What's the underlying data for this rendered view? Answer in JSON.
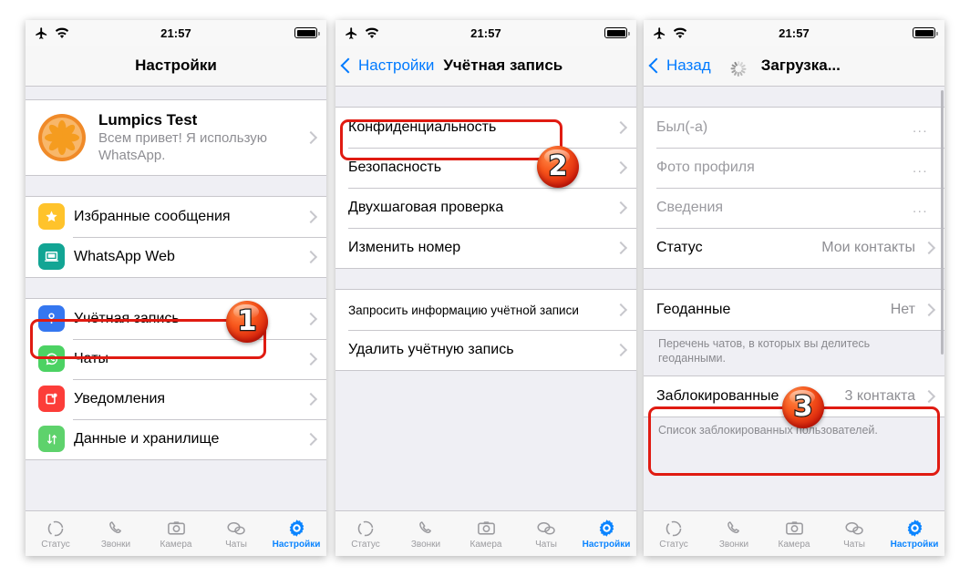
{
  "statusbar": {
    "time": "21:57",
    "airplane_icon": "airplane-icon",
    "wifi_icon": "wifi-icon",
    "battery_icon": "battery-icon"
  },
  "tabbar": {
    "items": [
      {
        "label": "Статус",
        "icon": "status-ring-icon",
        "active": false
      },
      {
        "label": "Звонки",
        "icon": "phone-icon",
        "active": false
      },
      {
        "label": "Камера",
        "icon": "camera-icon",
        "active": false
      },
      {
        "label": "Чаты",
        "icon": "chats-bubble-icon",
        "active": false
      },
      {
        "label": "Настройки",
        "icon": "gear-icon",
        "active": true
      }
    ]
  },
  "panel1": {
    "nav": {
      "title": "Настройки"
    },
    "profile": {
      "name": "Lumpics Test",
      "status": "Всем привет! Я использую WhatsApp.",
      "avatar": "orange-slice-avatar"
    },
    "group_a": [
      {
        "label": "Избранные сообщения",
        "icon": "star-icon",
        "color": "#ffc32b"
      },
      {
        "label": "WhatsApp Web",
        "icon": "laptop-icon",
        "color": "#12a594"
      }
    ],
    "group_b": [
      {
        "label": "Учётная запись",
        "icon": "key-icon",
        "color": "#3577f0"
      },
      {
        "label": "Чаты",
        "icon": "whatsapp-icon",
        "color": "#4cd263"
      },
      {
        "label": "Уведомления",
        "icon": "notification-icon",
        "color": "#fc3d39"
      },
      {
        "label": "Данные и хранилище",
        "icon": "updown-arrows-icon",
        "color": "#5ed26c"
      }
    ]
  },
  "panel2": {
    "nav": {
      "back_label": "Настройки",
      "title": "Учётная запись"
    },
    "group_a": [
      {
        "label": "Конфиденциальность"
      },
      {
        "label": "Безопасность"
      },
      {
        "label": "Двухшаговая проверка"
      },
      {
        "label": "Изменить номер"
      }
    ],
    "group_b": [
      {
        "label": "Запросить информацию учётной записи",
        "small": true
      },
      {
        "label": "Удалить учётную запись"
      }
    ]
  },
  "panel3": {
    "nav": {
      "back_label": "Назад",
      "title": "Загрузка...",
      "spinner": "loading-spinner-icon"
    },
    "group_a": [
      {
        "label": "Был(-а)",
        "value": "...",
        "dim": true
      },
      {
        "label": "Фото профиля",
        "value": "...",
        "dim": true
      },
      {
        "label": "Сведения",
        "value": "...",
        "dim": true
      },
      {
        "label": "Статус",
        "value": "Мои контакты",
        "dim": false
      }
    ],
    "geo": {
      "label": "Геоданные",
      "value": "Нет"
    },
    "geo_note": "Перечень чатов, в которых вы делитесь геоданными.",
    "blocked": {
      "label": "Заблокированные",
      "value": "3 контакта"
    },
    "blocked_note": "Список заблокированных пользователей."
  },
  "badges": [
    {
      "number": "1"
    },
    {
      "number": "2"
    },
    {
      "number": "3"
    }
  ],
  "colors": {
    "accent_blue": "#007aff",
    "highlight_red": "#e01b12",
    "badge_orange": "#f7551b"
  }
}
